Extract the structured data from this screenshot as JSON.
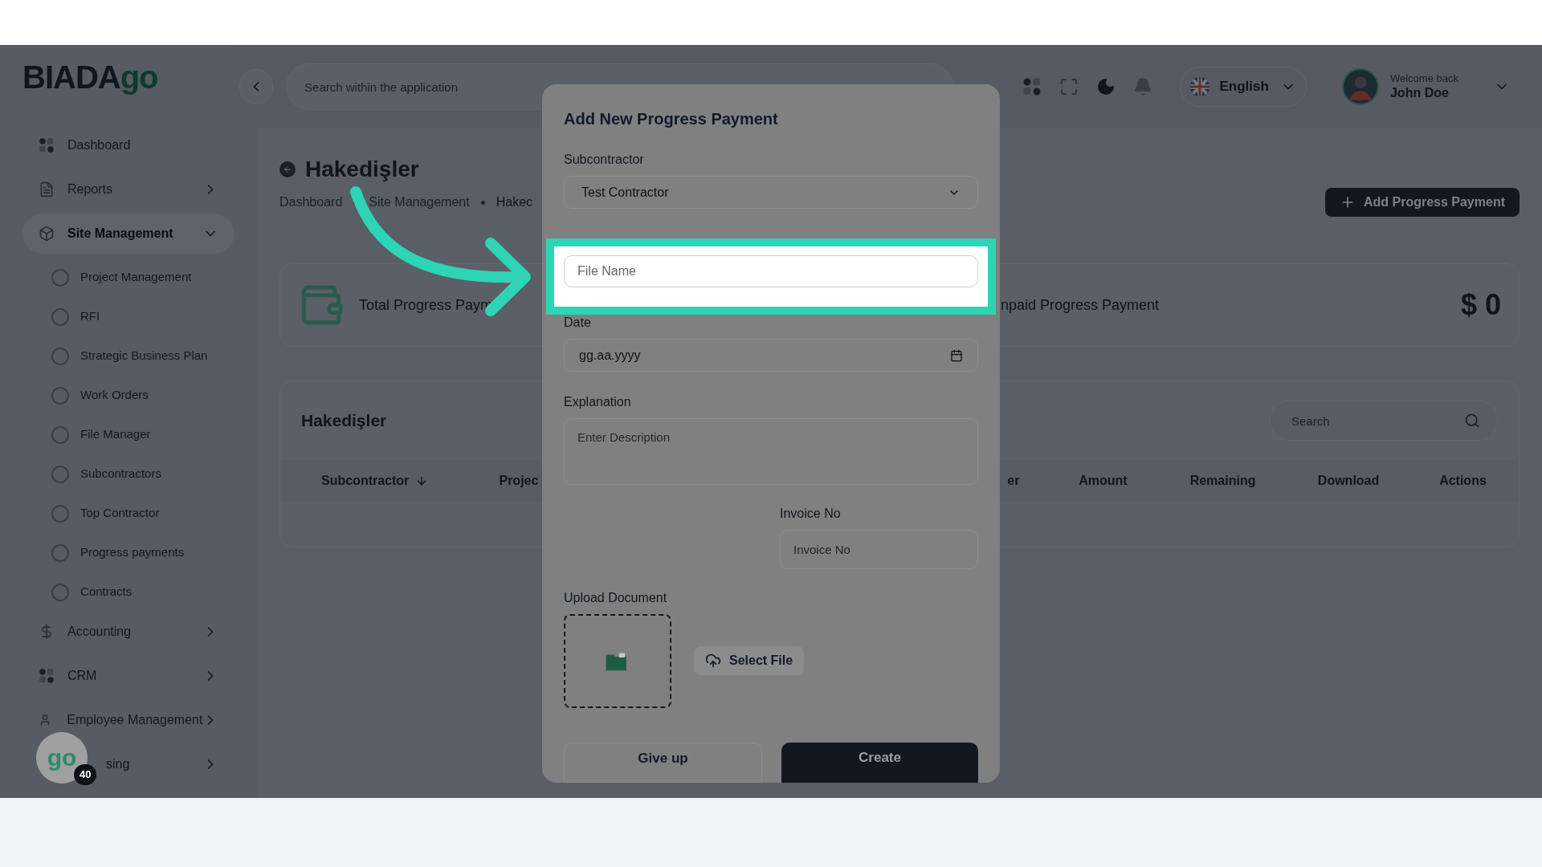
{
  "logo": {
    "text": "BIADA",
    "accent": "go"
  },
  "sidebar": {
    "items": [
      {
        "label": "Dashboard",
        "selected": false
      },
      {
        "label": "Reports",
        "selected": false,
        "expanded": false
      },
      {
        "label": "Site Management",
        "selected": true,
        "expanded": true,
        "children": [
          {
            "label": "Project Management",
            "selected": false
          },
          {
            "label": "RFI",
            "selected": false
          },
          {
            "label": "Strategic Business Plan",
            "selected": false
          },
          {
            "label": "Work Orders",
            "selected": false
          },
          {
            "label": "File Manager",
            "selected": false
          },
          {
            "label": "Subcontractors",
            "selected": false
          },
          {
            "label": "Top Contractor",
            "selected": false
          },
          {
            "label": "Progress payments",
            "selected": false
          },
          {
            "label": "Contracts",
            "selected": false
          }
        ]
      },
      {
        "label": "Accounting",
        "selected": false,
        "expanded": false
      },
      {
        "label": "CRM",
        "selected": false,
        "expanded": false
      },
      {
        "label": "Employee Management",
        "selected": false,
        "expanded": false
      },
      {
        "label": "sing",
        "selected": false,
        "expanded": false
      }
    ]
  },
  "help_badge": {
    "logo": "go",
    "count": "40"
  },
  "header": {
    "search": {
      "placeholder": "Search within the application"
    },
    "language": "English",
    "welcome": "Welcome back",
    "user": "John Doe"
  },
  "page": {
    "title": "Hakedişler",
    "breadcrumb": [
      "Dashboard",
      "Site Management",
      "Hakec"
    ],
    "add_button": "Add Progress Payment",
    "stats": [
      {
        "label": "Total Progress Paym"
      },
      {
        "label": "npaid Progress Payment",
        "value": "$ 0"
      }
    ],
    "table": {
      "title": "Hakedişler",
      "search": {
        "placeholder": "Search"
      },
      "columns": [
        "Subcontractor",
        "Projec",
        "er",
        "Amount",
        "Remaining",
        "Download",
        "Actions"
      ]
    }
  },
  "modal": {
    "title": "Add New Progress Payment",
    "subcontractor": {
      "label": "Subcontractor",
      "value": "Test Contractor"
    },
    "file_name": {
      "placeholder": "File Name",
      "focused": true
    },
    "date": {
      "label": "Date",
      "value": "gg.aa.yyyy"
    },
    "explanation": {
      "label": "Explanation",
      "placeholder": "Enter Description"
    },
    "invoice_no": {
      "label": "Invoice No",
      "placeholder": "Invoice No"
    },
    "upload": {
      "label": "Upload Document",
      "button": "Select File"
    },
    "buttons": [
      {
        "label": "Give up",
        "kind": "secondary"
      },
      {
        "label": "Create",
        "kind": "primary"
      }
    ]
  }
}
